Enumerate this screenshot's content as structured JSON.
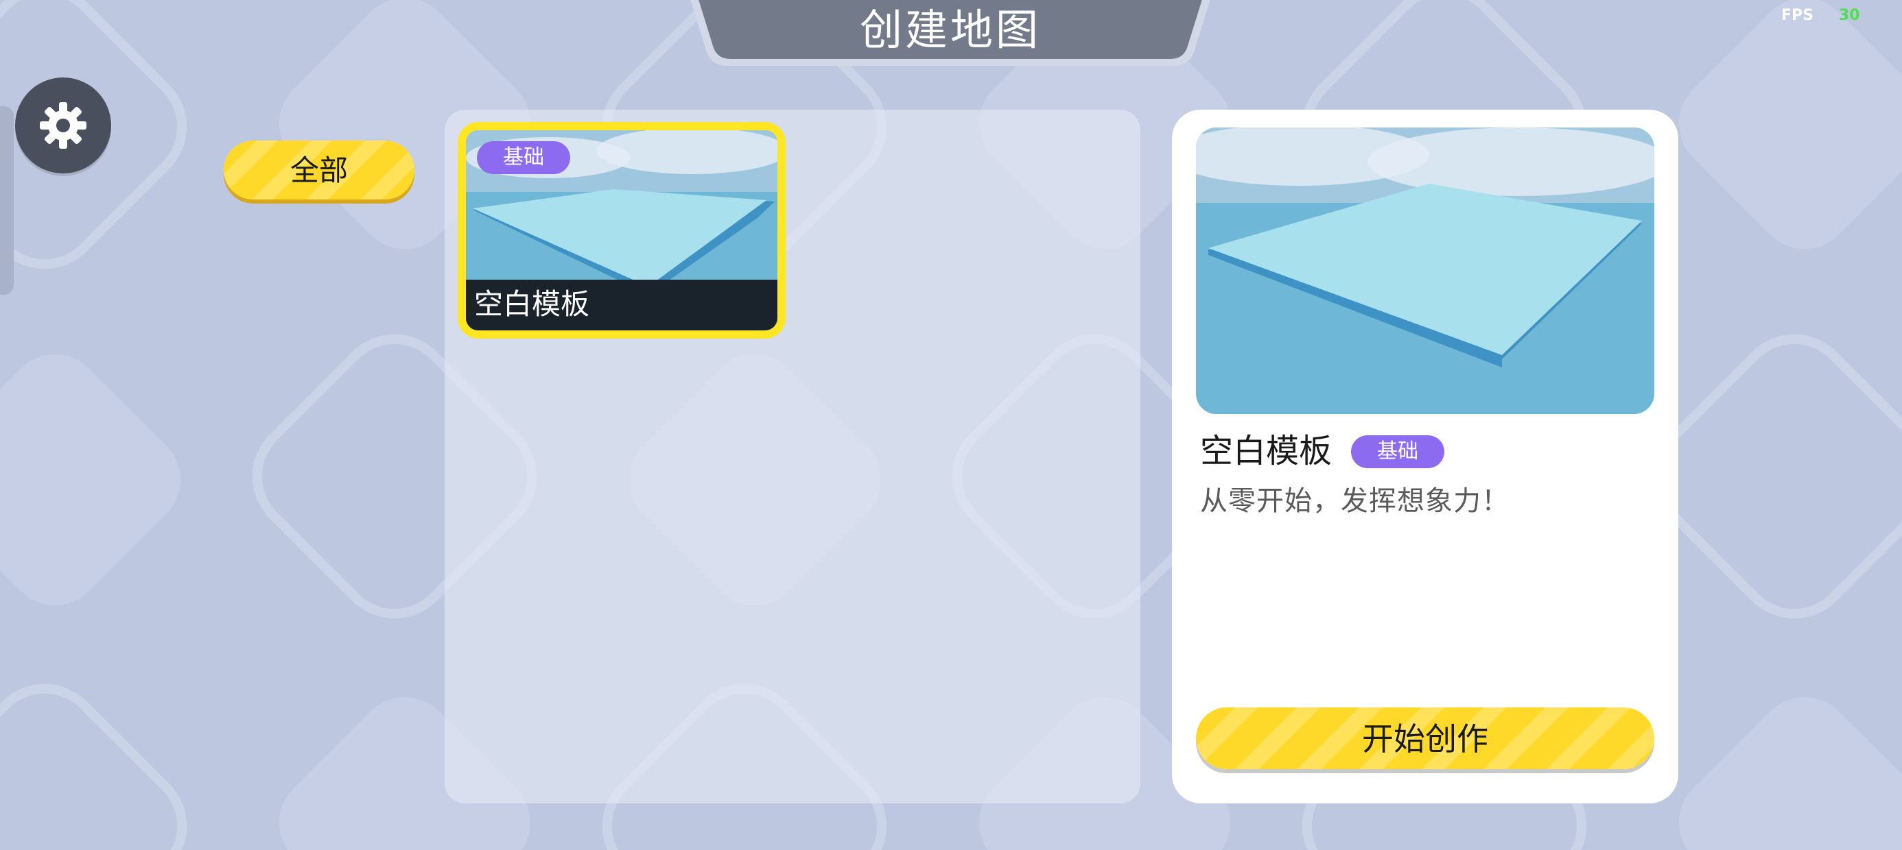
{
  "header": {
    "title": "创建地图"
  },
  "fps": {
    "label": "FPS",
    "value": "30"
  },
  "settings": {
    "icon": "gear-icon"
  },
  "categories": [
    {
      "label": "全部",
      "selected": true
    }
  ],
  "templates": [
    {
      "name": "空白模板",
      "tag": "基础",
      "selected": true
    }
  ],
  "detail": {
    "name": "空白模板",
    "tag": "基础",
    "description": "从零开始，发挥想象力！",
    "start_label": "开始创作"
  },
  "colors": {
    "accent_yellow": "#ffd92a",
    "tag_purple": "#8c6bf0",
    "background": "#bdc7e0",
    "fps_value": "#4ee04e"
  }
}
